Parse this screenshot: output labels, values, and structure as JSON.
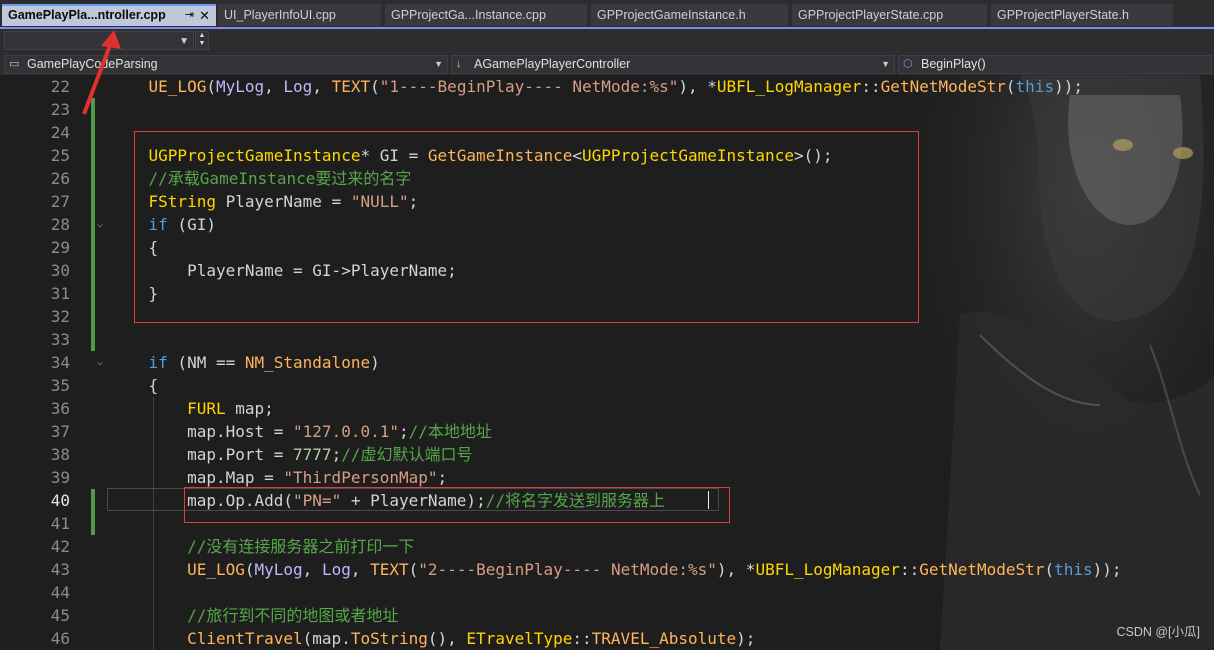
{
  "tabs": [
    {
      "label": "GamePlayPla...ntroller.cpp",
      "active": true,
      "pin": "⇥",
      "close": "✕"
    },
    {
      "label": "UI_PlayerInfoUI.cpp"
    },
    {
      "label": "GPProjectGa...Instance.cpp"
    },
    {
      "label": "GPProjectGameInstance.h"
    },
    {
      "label": "GPProjectPlayerState.cpp"
    },
    {
      "label": "GPProjectPlayerState.h"
    }
  ],
  "navbar": {
    "project": "GamePlayCodeParsing",
    "class": "AGamePlayPlayerController",
    "method": "BeginPlay()"
  },
  "code": [
    {
      "ln": "22",
      "parts": [
        [
          "f",
          "UE_LOG"
        ],
        [
          "p",
          "("
        ],
        [
          "m",
          "MyLog"
        ],
        [
          "p",
          ", "
        ],
        [
          "m",
          "Log"
        ],
        [
          "p",
          ", "
        ],
        [
          "f",
          "TEXT"
        ],
        [
          "p",
          "("
        ],
        [
          "s",
          "\"1----BeginPlay---- NetMode:%s\""
        ],
        [
          "p",
          "), *"
        ],
        [
          "ty",
          "UBFL_LogManager"
        ],
        [
          "p",
          "::"
        ],
        [
          "f",
          "GetNetModeStr"
        ],
        [
          "p",
          "("
        ],
        [
          "k",
          "this"
        ],
        [
          "p",
          "));"
        ]
      ]
    },
    {
      "ln": "23",
      "parts": []
    },
    {
      "ln": "24",
      "parts": []
    },
    {
      "ln": "25",
      "parts": [
        [
          "ty",
          "UGPProjectGameInstance"
        ],
        [
          "p",
          "* GI = "
        ],
        [
          "f",
          "GetGameInstance"
        ],
        [
          "p",
          "<"
        ],
        [
          "ty",
          "UGPProjectGameInstance"
        ],
        [
          "p",
          ">();"
        ]
      ]
    },
    {
      "ln": "26",
      "parts": [
        [
          "c",
          "//承载GameInstance要过来的名字"
        ]
      ]
    },
    {
      "ln": "27",
      "parts": [
        [
          "ty",
          "FString"
        ],
        [
          "p",
          " PlayerName = "
        ],
        [
          "s",
          "\"NULL\""
        ],
        [
          "p",
          ";"
        ]
      ]
    },
    {
      "ln": "28",
      "parts": [
        [
          "k",
          "if"
        ],
        [
          "p",
          " (GI)"
        ]
      ]
    },
    {
      "ln": "29",
      "parts": [
        [
          "p",
          "{"
        ]
      ]
    },
    {
      "ln": "30",
      "parts": [
        [
          "p",
          "    PlayerName = GI->PlayerName;"
        ]
      ]
    },
    {
      "ln": "31",
      "parts": [
        [
          "p",
          "}"
        ]
      ]
    },
    {
      "ln": "32",
      "parts": []
    },
    {
      "ln": "33",
      "parts": []
    },
    {
      "ln": "34",
      "parts": [
        [
          "k",
          "if"
        ],
        [
          "p",
          " (NM == "
        ],
        [
          "tr",
          "NM_Standalone"
        ],
        [
          "p",
          ")"
        ]
      ]
    },
    {
      "ln": "35",
      "parts": [
        [
          "p",
          "{"
        ]
      ]
    },
    {
      "ln": "36",
      "parts": [
        [
          "p",
          "    "
        ],
        [
          "ty",
          "FURL"
        ],
        [
          "p",
          " map;"
        ]
      ]
    },
    {
      "ln": "37",
      "parts": [
        [
          "p",
          "    map.Host = "
        ],
        [
          "s",
          "\"127.0.0.1\""
        ],
        [
          "p",
          ";"
        ],
        [
          "c",
          "//本地地址"
        ]
      ]
    },
    {
      "ln": "38",
      "parts": [
        [
          "p",
          "    map.Port = "
        ],
        [
          "n",
          "7777"
        ],
        [
          "p",
          ";"
        ],
        [
          "c",
          "//虚幻默认端口号"
        ]
      ]
    },
    {
      "ln": "39",
      "parts": [
        [
          "p",
          "    map.Map = "
        ],
        [
          "s",
          "\"ThirdPersonMap\""
        ],
        [
          "p",
          ";"
        ]
      ]
    },
    {
      "ln": "40",
      "parts": [
        [
          "p",
          "    map.Op.Add("
        ],
        [
          "s",
          "\"PN=\""
        ],
        [
          "p",
          " + PlayerName);"
        ],
        [
          "c",
          "//将名字发送到服务器上"
        ]
      ]
    },
    {
      "ln": "41",
      "parts": []
    },
    {
      "ln": "42",
      "parts": [
        [
          "p",
          "    "
        ],
        [
          "c",
          "//没有连接服务器之前打印一下"
        ]
      ]
    },
    {
      "ln": "43",
      "parts": [
        [
          "p",
          "    "
        ],
        [
          "f",
          "UE_LOG"
        ],
        [
          "p",
          "("
        ],
        [
          "m",
          "MyLog"
        ],
        [
          "p",
          ", "
        ],
        [
          "m",
          "Log"
        ],
        [
          "p",
          ", "
        ],
        [
          "f",
          "TEXT"
        ],
        [
          "p",
          "("
        ],
        [
          "s",
          "\"2----BeginPlay---- NetMode:%s\""
        ],
        [
          "p",
          "), *"
        ],
        [
          "ty",
          "UBFL_LogManager"
        ],
        [
          "p",
          "::"
        ],
        [
          "f",
          "GetNetModeStr"
        ],
        [
          "p",
          "("
        ],
        [
          "k",
          "this"
        ],
        [
          "p",
          "));"
        ]
      ]
    },
    {
      "ln": "44",
      "parts": []
    },
    {
      "ln": "45",
      "parts": [
        [
          "p",
          "    "
        ],
        [
          "c",
          "//旅行到不同的地图或者地址"
        ]
      ]
    },
    {
      "ln": "46",
      "parts": [
        [
          "p",
          "    "
        ],
        [
          "f",
          "ClientTravel"
        ],
        [
          "p",
          "(map."
        ],
        [
          "f",
          "ToString"
        ],
        [
          "p",
          "(), "
        ],
        [
          "ty",
          "ETravelType"
        ],
        [
          "p",
          "::"
        ],
        [
          "tr",
          "TRAVEL_Absolute"
        ],
        [
          "p",
          ");"
        ]
      ]
    }
  ],
  "watermark": "CSDN @[小瓜]"
}
